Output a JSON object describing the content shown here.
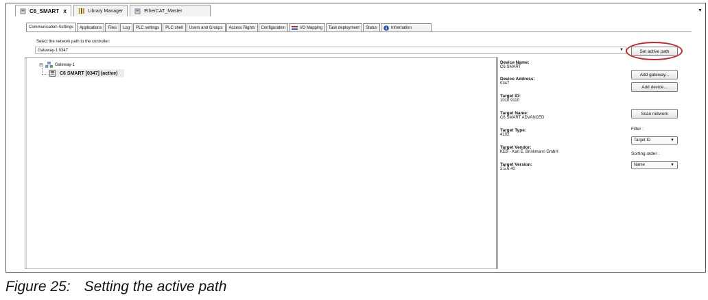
{
  "editor_tabs": [
    {
      "label": "C6_SMART",
      "active": true,
      "icon": "device-icon"
    },
    {
      "label": "Library Manager",
      "active": false,
      "icon": "library-icon"
    },
    {
      "label": "EtherCAT_Master",
      "active": false,
      "icon": "device-icon"
    }
  ],
  "editor_tabs_close": "x",
  "page_tabs": [
    "Communication Settings",
    "Applications",
    "Files",
    "Log",
    "PLC settings",
    "PLC shell",
    "Users and Groups",
    "Access Rights",
    "Configuration",
    "I/O Mapping",
    "Task deployment",
    "Status",
    "Information"
  ],
  "path": {
    "label": "Select the network path to the controller:",
    "value": "Gateway-1:0347"
  },
  "tree": {
    "root": "Gateway-1",
    "child": "C6 SMART [0347] (active)"
  },
  "device_info": [
    {
      "key": "Device Name:",
      "value": "C6 SMART"
    },
    {
      "key": "Device Address:",
      "value": "0347"
    },
    {
      "key": "Target ID:",
      "value": "1010 9110"
    },
    {
      "key": "Target Name:",
      "value": "C6 SMART ADVANCED"
    },
    {
      "key": "Target Type:",
      "value": "4102"
    },
    {
      "key": "Target Vendor:",
      "value": "KEB - Karl E. Brinkmann GmbH"
    },
    {
      "key": "Target Version:",
      "value": "3.5.6.40"
    }
  ],
  "buttons": {
    "set_active_path": "Set active path",
    "add_gateway": "Add gateway...",
    "add_device": "Add device...",
    "scan_network": "Scan network"
  },
  "filter": {
    "label": "Filter :",
    "value": "Target ID"
  },
  "sorting": {
    "label": "Sorting order :",
    "value": "Name"
  },
  "caption": {
    "figure": "Figure 25:",
    "text": "Setting the active path"
  },
  "colors": {
    "highlight_ring": "#d0212b"
  }
}
